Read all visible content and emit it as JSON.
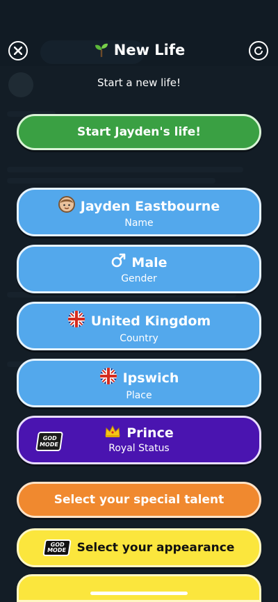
{
  "header": {
    "title": "New Life",
    "subtitle": "Start a new life!"
  },
  "buttons": {
    "start": "Start Jayden's life!",
    "name": {
      "value": "Jayden Eastbourne",
      "label": "Name"
    },
    "gender": {
      "value": "Male",
      "label": "Gender"
    },
    "country": {
      "value": "United Kingdom",
      "label": "Country"
    },
    "place": {
      "value": "Ipswich",
      "label": "Place"
    },
    "royal": {
      "value": "Prince",
      "label": "Royal Status",
      "badge": "GOD MODE"
    },
    "talent": "Select your special talent",
    "appearance": {
      "label": "Select your appearance",
      "badge": "GOD MODE"
    }
  },
  "colors": {
    "green": "#3aa043",
    "blue": "#53a8ec",
    "purple": "#4a14b0",
    "orange": "#f0892f",
    "yellow": "#fbe63d"
  },
  "icons": {
    "close": "close-icon",
    "refresh": "refresh-icon",
    "sprout": "sprout-icon",
    "avatar": "avatar-icon",
    "male": "male-symbol-icon",
    "flag": "uk-flag-icon",
    "crown": "crown-icon",
    "god_mode": "god-mode-icon"
  }
}
